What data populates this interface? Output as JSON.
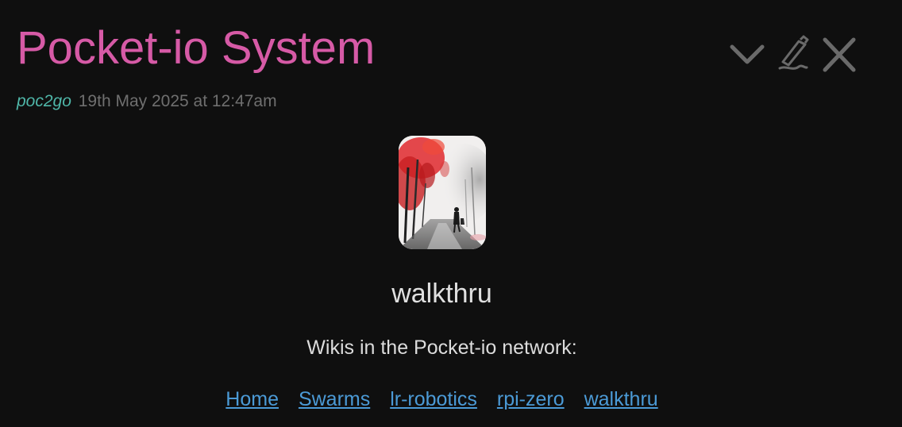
{
  "header": {
    "title": "Pocket-io System",
    "author": "poc2go",
    "date": "19th May 2025 at 12:47am"
  },
  "toolbar": {
    "icons": [
      "chevron-down-icon",
      "pencil-icon",
      "close-icon"
    ]
  },
  "content": {
    "image_icon": "watercolor-walker-image",
    "subtitle": "walkthru",
    "caption": "Wikis in the Pocket-io network:",
    "links": [
      "Home",
      "Swarms",
      "lr-robotics",
      "rpi-zero",
      "walkthru"
    ]
  },
  "colors": {
    "background": "#0f0f0f",
    "title": "#d65aa6",
    "author": "#4fb6a8",
    "date": "#6f6f6f",
    "link": "#4b9ad6",
    "icon": "#6a6a6a"
  }
}
